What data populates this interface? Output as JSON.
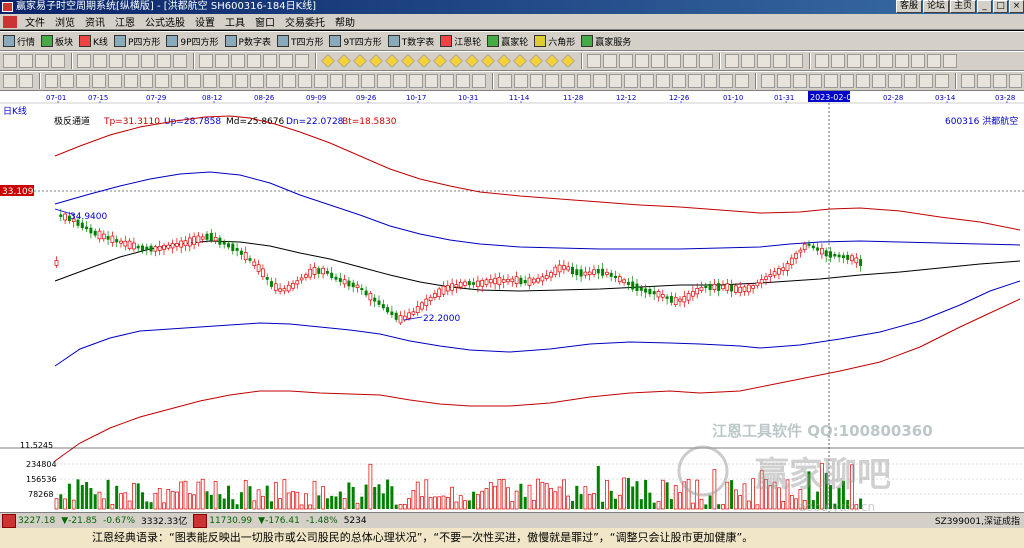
{
  "window": {
    "title": "赢家易子时空周期系统[纵横版] - [洪都航空   SH600316-184日K线]",
    "buttons": [
      "客服",
      "论坛",
      "主页"
    ],
    "controls": [
      "_",
      "□",
      "×"
    ]
  },
  "menu": [
    "文件",
    "浏览",
    "资讯",
    "江恩",
    "公式选股",
    "设置",
    "工具",
    "窗口",
    "交易委托",
    "帮助"
  ],
  "toolbar1": [
    "行情",
    "板块",
    "K线",
    "P四方形",
    "9P四方形",
    "P数字表",
    "T四方形",
    "9T四方形",
    "T数字表",
    "江恩轮",
    "赢家轮",
    "六角形",
    "赢家服务"
  ],
  "chart": {
    "period_label": "日K线",
    "indicator": "极反通道",
    "tp": "Tp=31.3110",
    "up": "Up=28.7858",
    "md": "Md=25.8676",
    "dn": "Dn=22.0728",
    "bt": "Bt=18.5830",
    "stock": "600316  洪都航空",
    "price_tag": "33.1097",
    "low_price": "11.5245",
    "dates": [
      "07-01",
      "07-15",
      "07-29",
      "08-12",
      "08-26",
      "09-09",
      "09-26",
      "10-17",
      "10-31",
      "11-14",
      "11-28",
      "12-12",
      "12-26",
      "01-10",
      "01-31",
      "2023-02-09",
      "02-28",
      "03-14",
      "03-28"
    ],
    "hi_annotation": "34.9400",
    "lo_annotation": "22.2000",
    "vol_labels": [
      "234804",
      "156536",
      "78268"
    ],
    "watermark1": "江恩工具软件  QQ:100800360",
    "watermark2": "赢家聊吧",
    "watermark3": "liaoba.yaxi.cn"
  },
  "status": {
    "sh_index": "3227.18",
    "sh_change": "▼-21.85",
    "sh_pct": "-0.67%",
    "sh_vol": "3332.33亿",
    "sz_index": "11730.99",
    "sz_change": "▼-176.41",
    "sz_pct": "-1.48%",
    "sz_vol": "5234",
    "right": "SZ399001,深证成指"
  },
  "quote": "江恩经典语录：“图表能反映出一切股市或公司股民的总体心理状况”，“不要一次性买进，傲慢就是罪过”，“调整只会让股市更加健康”。",
  "colors": {
    "up": "#e00000",
    "down": "#008000",
    "upper_band": "#c00000",
    "mid_band": "#0000c0",
    "ma": "#000000"
  }
}
